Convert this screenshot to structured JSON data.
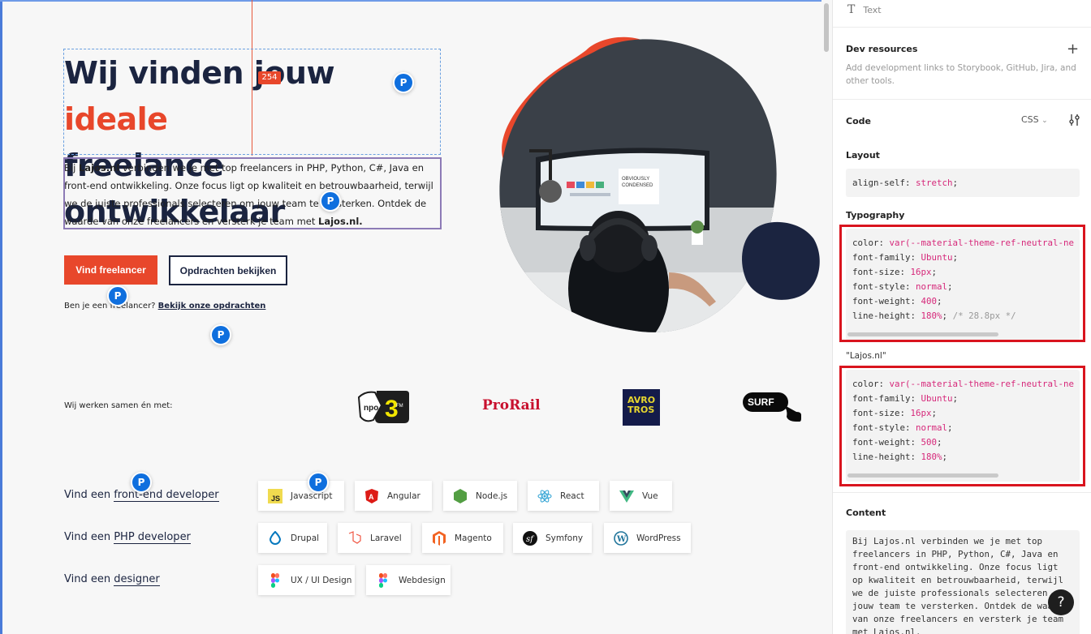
{
  "hero": {
    "title_line1_pre": "Wij vinden jouw ",
    "title_accent": "ideale",
    "title_line2": "freelance ontwikkelaar",
    "body": [
      {
        "t": "Bij "
      },
      {
        "t": "Lajos.nl",
        "b": true
      },
      {
        "t": " verbinden we je met top freelancers in PHP, Python, C#, Java en front-end ontwikkeling. Onze focus ligt op kwaliteit en betrouwbaarheid, terwijl we de juiste professionals selecteren om jouw team te versterken. Ontdek de waarde van onze freelancers en versterk je team met "
      },
      {
        "t": "Lajos.nl.",
        "b": true
      }
    ],
    "btn_primary": "Vind freelancer",
    "btn_secondary": "Opdrachten bekijken",
    "small_pre": "Ben je een freelancer? ",
    "small_link": "Bekijk onze opdrachten"
  },
  "overlay": {
    "measure_badge": "254",
    "pin_label": "P"
  },
  "partners": {
    "label": "Wij werken samen én met:",
    "logos": [
      "npo-3fm-logo",
      "prorail-logo",
      "avrotros-logo",
      "surf-logo"
    ],
    "prorail_text": "ProRail",
    "avrotros_text": "AVRO\nTROS",
    "surf_text": "SURF"
  },
  "skills": {
    "frontend": {
      "pre": "Vind een ",
      "link": "front-end developer",
      "chips": [
        "Javascript",
        "Angular",
        "Node.js",
        "React",
        "Vue"
      ]
    },
    "php": {
      "pre": "Vind een ",
      "link": "PHP developer",
      "chips": [
        "Drupal",
        "Laravel",
        "Magento",
        "Symfony",
        "WordPress"
      ]
    },
    "designer": {
      "pre": "Vind een ",
      "link": "designer",
      "chips": [
        "UX / UI Design",
        "Webdesign"
      ]
    }
  },
  "panel": {
    "text_row": "Text",
    "dev_resources": "Dev resources",
    "dev_desc": "Add development links to Storybook, GitHub, Jira, and other tools.",
    "code_heading": "Code",
    "code_lang": "CSS",
    "layout_heading": "Layout",
    "layout_code": [
      {
        "p": "align-self",
        "v": "stretch",
        "c": ""
      }
    ],
    "typography_heading": "Typography",
    "typography_code": [
      {
        "p": "color",
        "v": "var(--material-theme-ref-neutral-ne",
        "c": ""
      },
      {
        "p": "font-family",
        "v": "Ubuntu",
        "c": ""
      },
      {
        "p": "font-size",
        "v": "16px",
        "c": ""
      },
      {
        "p": "font-style",
        "v": "normal",
        "c": ""
      },
      {
        "p": "font-weight",
        "v": "400",
        "c": ""
      },
      {
        "p": "line-height",
        "v": "180%",
        "c": "/* 28.8px */"
      }
    ],
    "lajos_label": "\"Lajos.nl\"",
    "lajos_code": [
      {
        "p": "color",
        "v": "var(--material-theme-ref-neutral-ne",
        "c": ""
      },
      {
        "p": "font-family",
        "v": "Ubuntu",
        "c": ""
      },
      {
        "p": "font-size",
        "v": "16px",
        "c": ""
      },
      {
        "p": "font-style",
        "v": "normal",
        "c": ""
      },
      {
        "p": "font-weight",
        "v": "500",
        "c": ""
      },
      {
        "p": "line-height",
        "v": "180%",
        "c": ""
      }
    ],
    "content_heading": "Content",
    "content_text": "Bij Lajos.nl verbinden we je met top freelancers in PHP, Python, C#, Java en front-end ontwikkeling. Onze focus ligt op kwaliteit en betrouwbaarheid, terwijl we de juiste professionals selecteren om jouw team te versterken. Ontdek de waarde van onze freelancers en versterk je team met Lajos.nl.",
    "help": "?"
  },
  "colors": {
    "accent": "#e8472b",
    "navy": "#1b2440",
    "highlight": "#d9141e",
    "pin": "#0f6fde"
  }
}
